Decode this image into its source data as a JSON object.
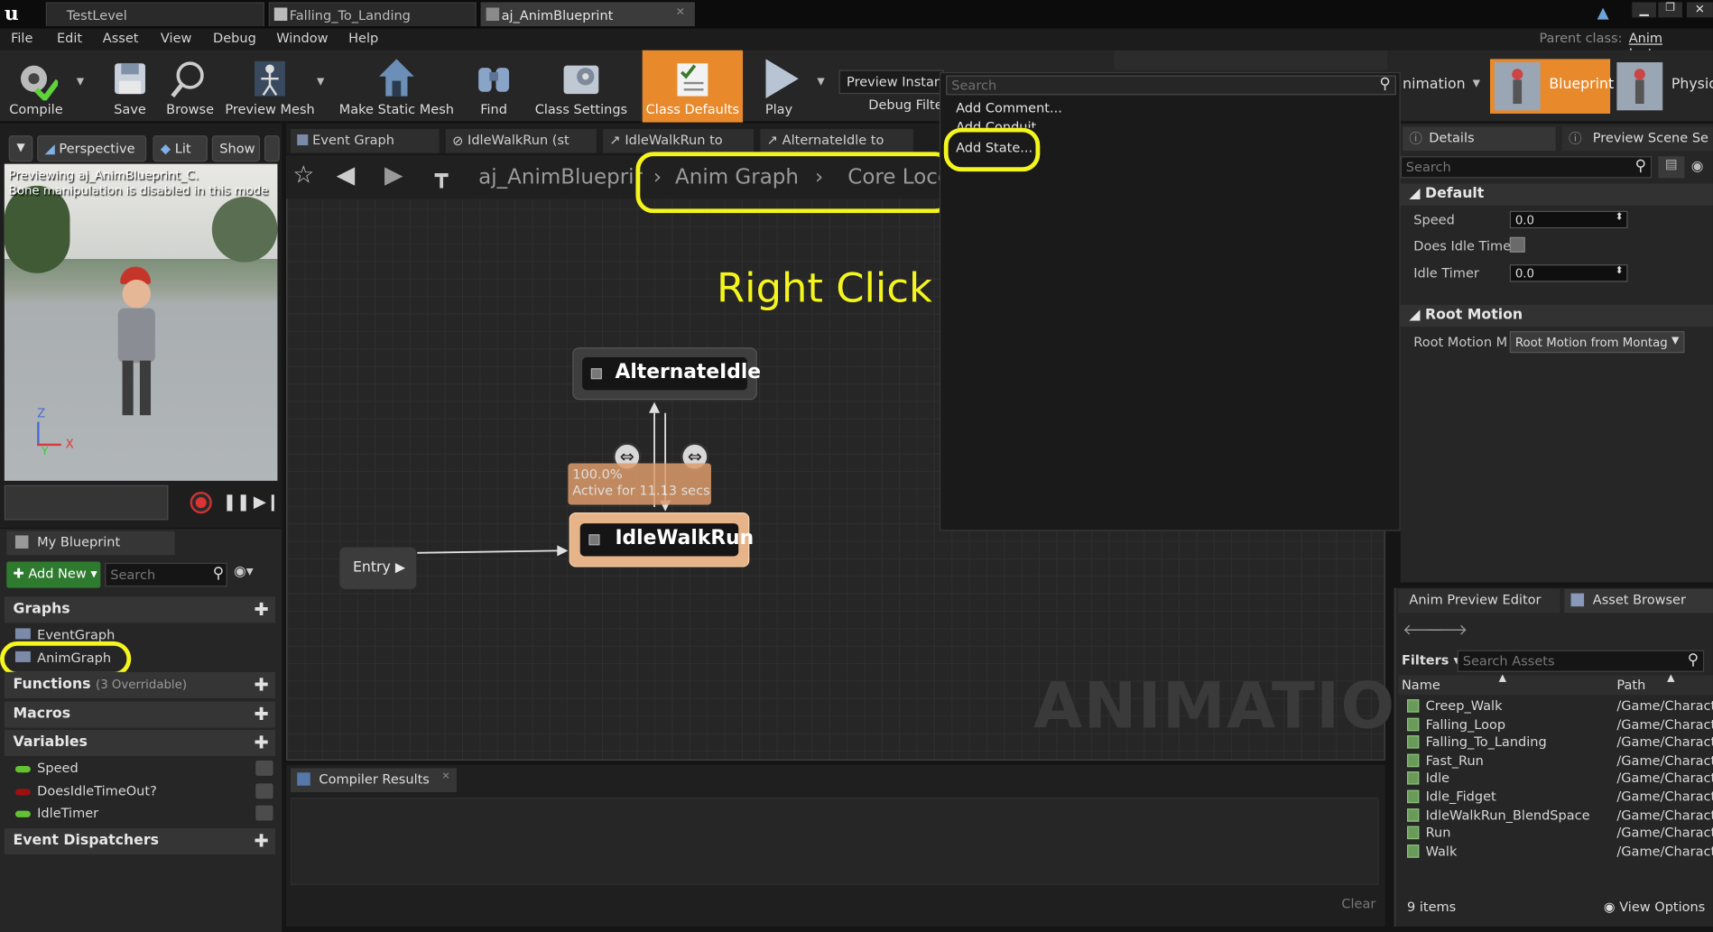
{
  "window": {
    "tabs": [
      "TestLevel",
      "Falling_To_Landing",
      "aj_AnimBlueprint"
    ],
    "parent_class_label": "Parent class:",
    "parent_class_value": "Anim Instanc"
  },
  "menu": [
    "File",
    "Edit",
    "Asset",
    "View",
    "Debug",
    "Window",
    "Help"
  ],
  "toolbar": {
    "compile": "Compile",
    "save": "Save",
    "browse": "Browse",
    "preview_mesh": "Preview Mesh",
    "make_static_mesh": "Make Static Mesh",
    "find": "Find",
    "class_settings": "Class Settings",
    "class_defaults": "Class Defaults",
    "play": "Play",
    "preview_instance": "Preview Instan",
    "debug_filter": "Debug Filte",
    "animation": "nimation",
    "blueprint": "Blueprint",
    "physics": "Physic"
  },
  "viewport": {
    "perspective": "Perspective",
    "lit": "Lit",
    "show": "Show",
    "notice_line1": "Previewing aj_AnimBlueprint_C.",
    "notice_line2": "Bone manipulation is disabled in this mode",
    "axis_z": "Z",
    "axis_x": "X",
    "axis_y": "Y"
  },
  "graph_tabs": [
    "Event Graph",
    "IdleWalkRun (st",
    "IdleWalkRun to",
    "AlternateIdle to"
  ],
  "breadcrumb": {
    "root": "aj_AnimBlueprin",
    "anim_graph": "Anim Graph",
    "core_loco": "Core Loco"
  },
  "annotation": "Right Click",
  "watermark": "ANIMATION",
  "graph": {
    "entry": "Entry",
    "state_alternate": "AlternateIdle",
    "state_idle": "IdleWalkRun",
    "weight": "100.0%",
    "active_for": "Active for 11.13 secs"
  },
  "context_menu": {
    "search_placeholder": "Search",
    "items": [
      "Add Comment...",
      "Add Conduit...",
      "Add State..."
    ]
  },
  "my_blueprint": {
    "tab": "My Blueprint",
    "add_new": "Add New",
    "search_placeholder": "Search",
    "graphs_header": "Graphs",
    "graphs": [
      "EventGraph",
      "AnimGraph"
    ],
    "functions_header": "Functions",
    "functions_note": "(3 Overridable)",
    "macros_header": "Macros",
    "variables_header": "Variables",
    "variables": [
      {
        "name": "Speed",
        "color": "#62c232"
      },
      {
        "name": "DoesIdleTimeOut?",
        "color": "#9b1010"
      },
      {
        "name": "IdleTimer",
        "color": "#62c232"
      }
    ],
    "dispatchers_header": "Event Dispatchers"
  },
  "compiler": {
    "tab": "Compiler Results",
    "clear": "Clear"
  },
  "details": {
    "tab": "Details",
    "tab2": "Preview Scene Se",
    "search_placeholder": "Search",
    "default_header": "Default",
    "speed_label": "Speed",
    "speed_value": "0.0",
    "idle_timeout_label": "Does Idle Time",
    "idle_timer_label": "Idle Timer",
    "idle_timer_value": "0.0",
    "root_motion_header": "Root Motion",
    "root_motion_label": "Root Motion Mc",
    "root_motion_value": "Root Motion from Montag"
  },
  "asset_browser": {
    "tab1": "Anim Preview Editor",
    "tab2": "Asset Browser",
    "filters": "Filters",
    "search_placeholder": "Search Assets",
    "col_name": "Name",
    "col_path": "Path",
    "assets": [
      {
        "name": "Creep_Walk",
        "path": "/Game/Charact"
      },
      {
        "name": "Falling_Loop",
        "path": "/Game/Charact"
      },
      {
        "name": "Falling_To_Landing",
        "path": "/Game/Charact"
      },
      {
        "name": "Fast_Run",
        "path": "/Game/Charact"
      },
      {
        "name": "Idle",
        "path": "/Game/Charact"
      },
      {
        "name": "Idle_Fidget",
        "path": "/Game/Charact"
      },
      {
        "name": "IdleWalkRun_BlendSpace",
        "path": "/Game/Charact"
      },
      {
        "name": "Run",
        "path": "/Game/Charact"
      },
      {
        "name": "Walk",
        "path": "/Game/Charact"
      }
    ],
    "count": "9 items",
    "view_options": "View Options"
  },
  "colors": {
    "accent_orange": "#e8892c",
    "highlight_yellow": "#f5f51e",
    "node_active": "#e7b48a"
  }
}
